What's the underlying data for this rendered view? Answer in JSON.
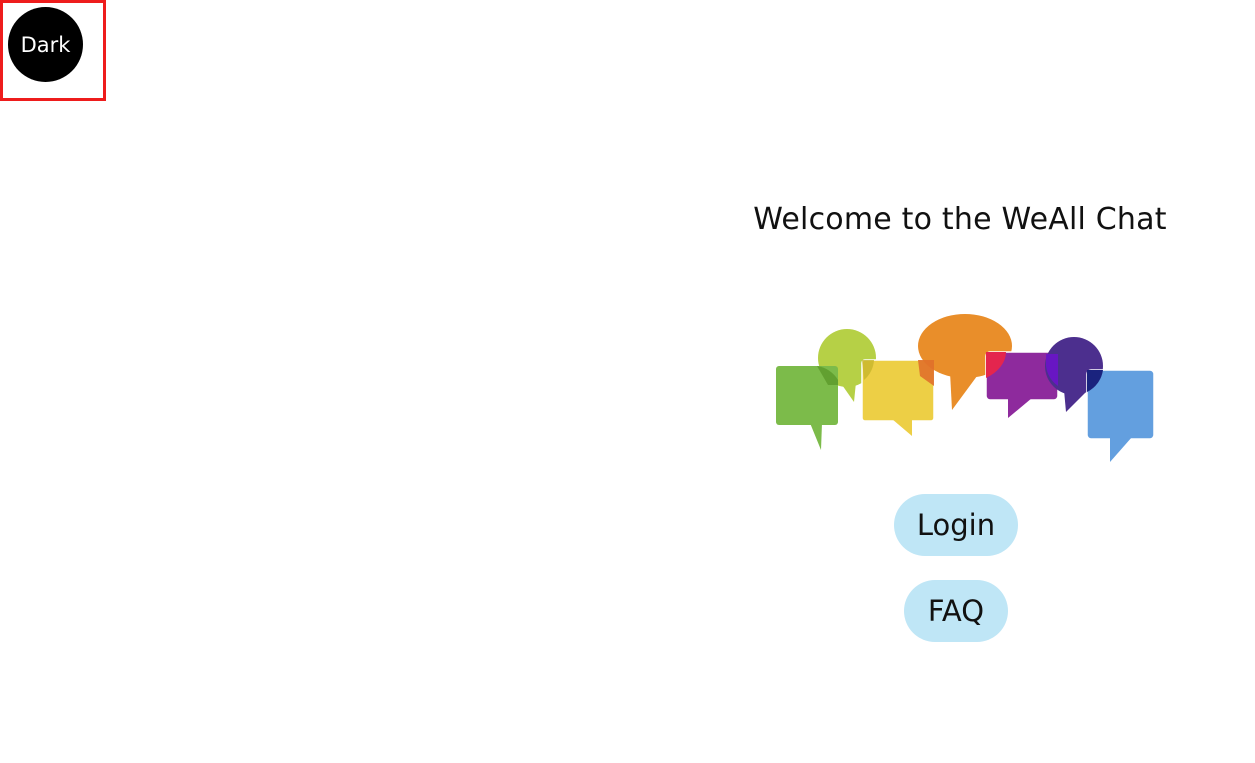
{
  "theme_toggle": {
    "label": "Dark"
  },
  "welcome": {
    "title": "Welcome to the WeAll Chat"
  },
  "logo": {
    "icon": "speech-bubbles-logo",
    "colors": [
      "#7cbb4a",
      "#b6d046",
      "#edcf45",
      "#e98e2a",
      "#8e2a9d",
      "#4c2f8e",
      "#639fdf"
    ]
  },
  "actions": {
    "login_label": "Login",
    "faq_label": "FAQ"
  },
  "colors": {
    "button_bg": "#bfe6f6",
    "toggle_bg": "#000000",
    "highlight_border": "#ee1c1c"
  }
}
